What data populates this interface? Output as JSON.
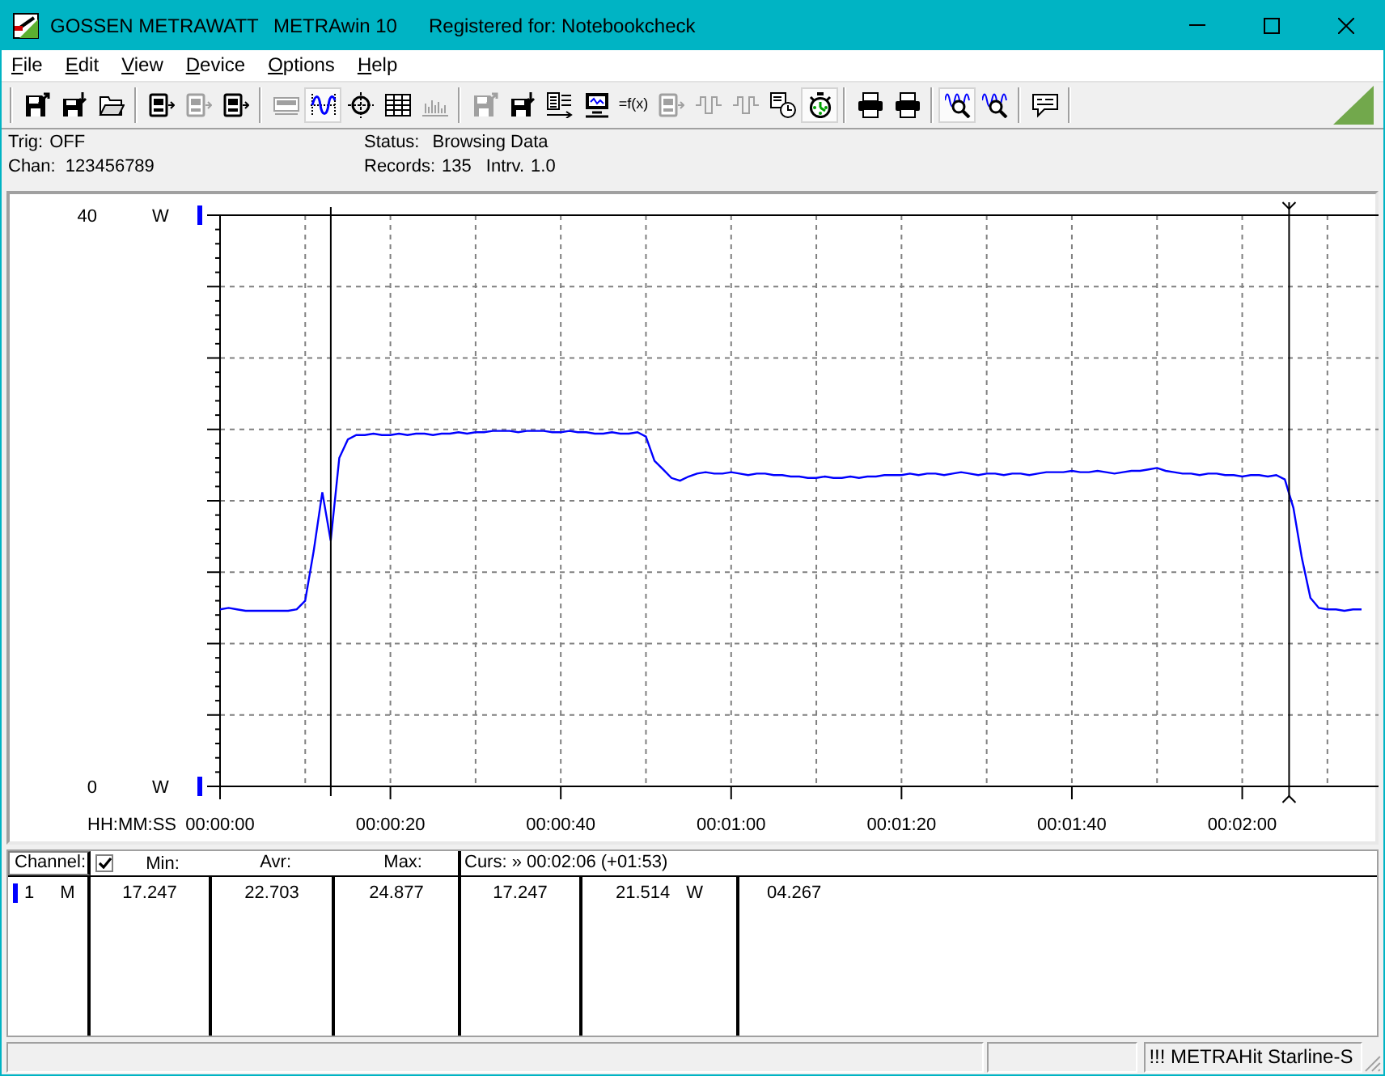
{
  "title_bar": {
    "company": "GOSSEN METRAWATT",
    "app": "METRAwin 10",
    "registration": "Registered for: Notebookcheck"
  },
  "menu": [
    "File",
    "Edit",
    "View",
    "Device",
    "Options",
    "Help"
  ],
  "toolbar": {
    "groups": [
      [
        {
          "selected": false,
          "disabled": false
        },
        {
          "selected": false,
          "disabled": false
        },
        {
          "selected": false,
          "disabled": false
        }
      ],
      [
        {
          "selected": false,
          "disabled": false
        },
        {
          "selected": false,
          "disabled": true
        },
        {
          "selected": false,
          "disabled": false
        }
      ],
      [
        {
          "selected": false,
          "disabled": true
        },
        {
          "selected": true,
          "disabled": false
        },
        {
          "selected": false,
          "disabled": false
        },
        {
          "selected": false,
          "disabled": false
        },
        {
          "selected": false,
          "disabled": true
        }
      ],
      [
        {
          "selected": false,
          "disabled": true
        },
        {
          "selected": false,
          "disabled": false
        },
        {
          "selected": false,
          "disabled": false
        },
        {
          "selected": false,
          "disabled": false
        },
        {
          "label": "=f(x)",
          "selected": false,
          "disabled": false
        },
        {
          "selected": false,
          "disabled": true
        },
        {
          "selected": false,
          "disabled": true
        },
        {
          "selected": false,
          "disabled": true
        },
        {
          "selected": false,
          "disabled": false
        },
        {
          "selected": true,
          "disabled": false
        }
      ],
      [
        {
          "selected": false,
          "disabled": false
        },
        {
          "selected": false,
          "disabled": false
        }
      ],
      [
        {
          "selected": true,
          "disabled": false
        },
        {
          "selected": false,
          "disabled": false
        }
      ],
      [
        {
          "selected": false,
          "disabled": false
        }
      ]
    ]
  },
  "info": {
    "trigger": {
      "label": "Trig:",
      "value": "OFF"
    },
    "channels": {
      "label": "Chan:",
      "value": "123456789"
    },
    "status": {
      "label": "Status:",
      "value": "Browsing Data"
    },
    "records": {
      "label": "Records:",
      "value": "135"
    },
    "interval": {
      "label": "Intrv.",
      "value": "1.0"
    }
  },
  "chart": {
    "unit_labels": [
      "W",
      "W"
    ],
    "cursors": [
      {
        "caret": false
      },
      {
        "caret": true
      }
    ],
    "chart_data": {
      "type": "line",
      "xlabel": "HH:MM:SS",
      "x": [
        0,
        1,
        2,
        3,
        4,
        5,
        6,
        7,
        8,
        9,
        10,
        11,
        12,
        13,
        14,
        15,
        16,
        17,
        18,
        19,
        20,
        21,
        22,
        23,
        24,
        25,
        26,
        27,
        28,
        29,
        30,
        31,
        32,
        33,
        34,
        35,
        36,
        37,
        38,
        39,
        40,
        41,
        42,
        43,
        44,
        45,
        46,
        47,
        48,
        49,
        50,
        51,
        52,
        53,
        54,
        55,
        56,
        57,
        58,
        59,
        60,
        61,
        62,
        63,
        64,
        65,
        66,
        67,
        68,
        69,
        70,
        71,
        72,
        73,
        74,
        75,
        76,
        77,
        78,
        79,
        80,
        81,
        82,
        83,
        84,
        85,
        86,
        87,
        88,
        89,
        90,
        91,
        92,
        93,
        94,
        95,
        96,
        97,
        98,
        99,
        100,
        101,
        102,
        103,
        104,
        105,
        106,
        107,
        108,
        109,
        110,
        111,
        112,
        113,
        114,
        115,
        116,
        117,
        118,
        119,
        120,
        121,
        122,
        123,
        124,
        125,
        126,
        127,
        128,
        129,
        130,
        131,
        132,
        133,
        134
      ],
      "series": [
        {
          "color": "#0000ff",
          "values": [
            12.4,
            12.5,
            12.4,
            12.3,
            12.3,
            12.3,
            12.3,
            12.3,
            12.3,
            12.4,
            13.0,
            16.5,
            20.6,
            17.2,
            23.0,
            24.3,
            24.6,
            24.6,
            24.7,
            24.6,
            24.6,
            24.7,
            24.6,
            24.7,
            24.7,
            24.6,
            24.7,
            24.7,
            24.8,
            24.7,
            24.8,
            24.8,
            24.9,
            24.9,
            24.9,
            24.8,
            24.9,
            24.9,
            24.9,
            24.8,
            24.8,
            24.9,
            24.8,
            24.8,
            24.7,
            24.7,
            24.8,
            24.7,
            24.7,
            24.8,
            24.5,
            22.8,
            22.2,
            21.6,
            21.4,
            21.7,
            21.9,
            22.0,
            21.9,
            21.9,
            22.0,
            21.9,
            21.8,
            21.9,
            21.9,
            21.8,
            21.8,
            21.7,
            21.7,
            21.6,
            21.6,
            21.7,
            21.6,
            21.6,
            21.7,
            21.6,
            21.7,
            21.7,
            21.8,
            21.8,
            21.8,
            21.9,
            21.8,
            21.9,
            21.9,
            21.8,
            21.9,
            22.0,
            21.9,
            21.8,
            21.9,
            21.9,
            21.8,
            21.9,
            21.9,
            21.8,
            21.9,
            22.0,
            22.0,
            22.0,
            22.1,
            22.0,
            22.0,
            22.1,
            22.0,
            21.9,
            22.0,
            22.1,
            22.1,
            22.2,
            22.3,
            22.1,
            22.0,
            21.9,
            21.9,
            21.8,
            21.9,
            21.9,
            21.8,
            21.8,
            21.7,
            21.8,
            21.8,
            21.7,
            21.8,
            21.5,
            19.5,
            16.0,
            13.2,
            12.5,
            12.4,
            12.4,
            12.3,
            12.4,
            12.4
          ]
        }
      ],
      "xlim": [
        0,
        136
      ],
      "ylim": [
        0,
        40
      ],
      "xticks": [
        {
          "value": 0,
          "label": "00:00:00"
        },
        {
          "value": 20,
          "label": "00:00:20"
        },
        {
          "value": 40,
          "label": "00:00:40"
        },
        {
          "value": 60,
          "label": "00:01:00"
        },
        {
          "value": 80,
          "label": "00:01:20"
        },
        {
          "value": 100,
          "label": "00:01:40"
        },
        {
          "value": 120,
          "label": "00:02:00"
        }
      ],
      "yticks": [
        0,
        40
      ],
      "grid": true,
      "ref_lines": [
        {
          "axis": "x",
          "value": 13
        },
        {
          "axis": "x",
          "value": 125.5
        }
      ]
    }
  },
  "stats_table": {
    "channel_heading": "Channel:",
    "checked": true,
    "headings": [
      "Min:",
      "Avr:",
      "Max:"
    ],
    "cursor_heading": "Curs: » 00:02:06 (+01:53)",
    "rows": [
      {
        "channel": "1",
        "mode": "M",
        "color": "#0000ff",
        "cells": [
          {
            "value": "17.247"
          },
          {
            "value": "22.703"
          },
          {
            "value": "24.877"
          },
          {
            "value": "17.247"
          },
          {
            "value": "21.514",
            "unit": "W"
          },
          {
            "value": "04.267"
          }
        ]
      }
    ]
  },
  "status_bar": {
    "message": "!!! METRAHit Starline-S"
  }
}
